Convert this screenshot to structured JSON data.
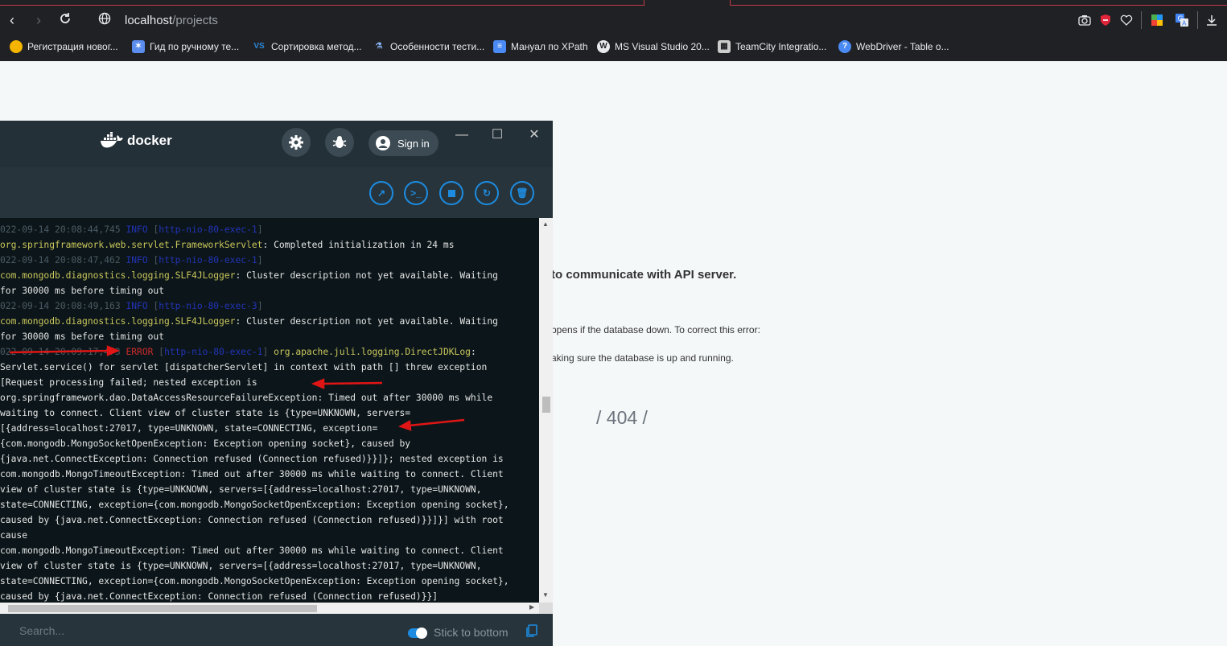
{
  "browser": {
    "url_host": "localhost",
    "url_path": "/projects",
    "bookmarks": [
      {
        "label": "Регистрация новог...",
        "icon": "globe-icon",
        "color": "#f4b400"
      },
      {
        "label": "Гид по ручному те...",
        "icon": "star-icon",
        "color": "#5b8def"
      },
      {
        "label": "Сортировка метод...",
        "icon": "vs-icon",
        "color": "#2b88d8"
      },
      {
        "label": "Особенности тести...",
        "icon": "flask-icon",
        "color": "#8ab4f8"
      },
      {
        "label": "Мануал по XPath",
        "icon": "doc-icon",
        "color": "#4a8af4"
      },
      {
        "label": "MS Visual Studio 20...",
        "icon": "wordpress-icon",
        "color": "#e8eaed"
      },
      {
        "label": "TeamCity Integratio...",
        "icon": "building-icon",
        "color": "#cccccc"
      },
      {
        "label": "WebDriver - Table o...",
        "icon": "help-icon",
        "color": "#4a8af4"
      }
    ]
  },
  "page": {
    "error_title": "to communicate with API server.",
    "error_desc": "ppens if the database down. To correct this error:",
    "error_step": "aking sure the database is up and running.",
    "error_code": "/ 404 /"
  },
  "docker": {
    "brand": "docker",
    "sign_in": "Sign in",
    "log_lines": [
      [
        {
          "t": "022-09-14 20:08:44,745 ",
          "c": "dim"
        },
        {
          "t": "INFO",
          "c": "info"
        },
        {
          "t": " [",
          "c": "dim"
        },
        {
          "t": "http-nio-80-exec-1",
          "c": "info"
        },
        {
          "t": "]",
          "c": "dim"
        }
      ],
      [
        {
          "t": "org.springframework.web.servlet.FrameworkServlet",
          "c": "yel"
        },
        {
          "t": ": Completed initialization in 24 ms",
          "c": "txt"
        }
      ],
      [
        {
          "t": "022-09-14 20:08:47,462 ",
          "c": "dim"
        },
        {
          "t": "INFO",
          "c": "info"
        },
        {
          "t": " [",
          "c": "dim"
        },
        {
          "t": "http-nio-80-exec-1",
          "c": "info"
        },
        {
          "t": "]",
          "c": "dim"
        }
      ],
      [
        {
          "t": "com.mongodb.diagnostics.logging.SLF4JLogger",
          "c": "yel"
        },
        {
          "t": ": Cluster description not yet available. Waiting",
          "c": "txt"
        }
      ],
      [
        {
          "t": "for 30000 ms before timing out",
          "c": "txt"
        }
      ],
      [
        {
          "t": "022-09-14 20:08:49,163 ",
          "c": "dim"
        },
        {
          "t": "INFO",
          "c": "info"
        },
        {
          "t": " [",
          "c": "dim"
        },
        {
          "t": "http-nio-80-exec-3",
          "c": "info"
        },
        {
          "t": "]",
          "c": "dim"
        }
      ],
      [
        {
          "t": "com.mongodb.diagnostics.logging.SLF4JLogger",
          "c": "yel"
        },
        {
          "t": ": Cluster description not yet available. Waiting",
          "c": "txt"
        }
      ],
      [
        {
          "t": "for 30000 ms before timing out",
          "c": "txt"
        }
      ],
      [
        {
          "t": "022-09-14 20:09:17,473 ",
          "c": "dim"
        },
        {
          "t": "ERROR",
          "c": "err"
        },
        {
          "t": " [",
          "c": "dim"
        },
        {
          "t": "http-nio-80-exec-1",
          "c": "info"
        },
        {
          "t": "] ",
          "c": "dim"
        },
        {
          "t": "org.apache.juli.logging.DirectJDKLog",
          "c": "yel"
        },
        {
          "t": ":",
          "c": "txt"
        }
      ],
      [
        {
          "t": "Servlet.service() for servlet [dispatcherServlet] in context with path [] threw exception",
          "c": "txt"
        }
      ],
      [
        {
          "t": "[Request processing failed; nested exception is",
          "c": "txt"
        }
      ],
      [
        {
          "t": "org.springframework.dao.DataAccessResourceFailureException: Timed out after 30000 ms while",
          "c": "txt"
        }
      ],
      [
        {
          "t": "waiting to connect. Client view of cluster state is {type=UNKNOWN, servers=",
          "c": "txt"
        }
      ],
      [
        {
          "t": "[{address=localhost:27017, type=UNKNOWN, state=CONNECTING, exception=",
          "c": "txt"
        }
      ],
      [
        {
          "t": "{com.mongodb.MongoSocketOpenException: Exception opening socket}, caused by",
          "c": "txt"
        }
      ],
      [
        {
          "t": "{java.net.ConnectException: Connection refused (Connection refused)}}]}; nested exception is",
          "c": "txt"
        }
      ],
      [
        {
          "t": "com.mongodb.MongoTimeoutException: Timed out after 30000 ms while waiting to connect. Client",
          "c": "txt"
        }
      ],
      [
        {
          "t": "view of cluster state is {type=UNKNOWN, servers=[{address=localhost:27017, type=UNKNOWN,",
          "c": "txt"
        }
      ],
      [
        {
          "t": "state=CONNECTING, exception={com.mongodb.MongoSocketOpenException: Exception opening socket},",
          "c": "txt"
        }
      ],
      [
        {
          "t": "caused by {java.net.ConnectException: Connection refused (Connection refused)}}]}] with root",
          "c": "txt"
        }
      ],
      [
        {
          "t": "cause",
          "c": "txt"
        }
      ],
      [
        {
          "t": "com.mongodb.MongoTimeoutException: Timed out after 30000 ms while waiting to connect. Client",
          "c": "txt"
        }
      ],
      [
        {
          "t": "view of cluster state is {type=UNKNOWN, servers=[{address=localhost:27017, type=UNKNOWN,",
          "c": "txt"
        }
      ],
      [
        {
          "t": "state=CONNECTING, exception={com.mongodb.MongoSocketOpenException: Exception opening socket},",
          "c": "txt"
        }
      ],
      [
        {
          "t": "caused by {java.net.ConnectException: Connection refused (Connection refused)}}]",
          "c": "txt"
        }
      ]
    ],
    "search_placeholder": "Search...",
    "stick_to_bottom": "Stick to bottom",
    "accent": "#1d8ce0",
    "annotation_color": "#e01515"
  }
}
